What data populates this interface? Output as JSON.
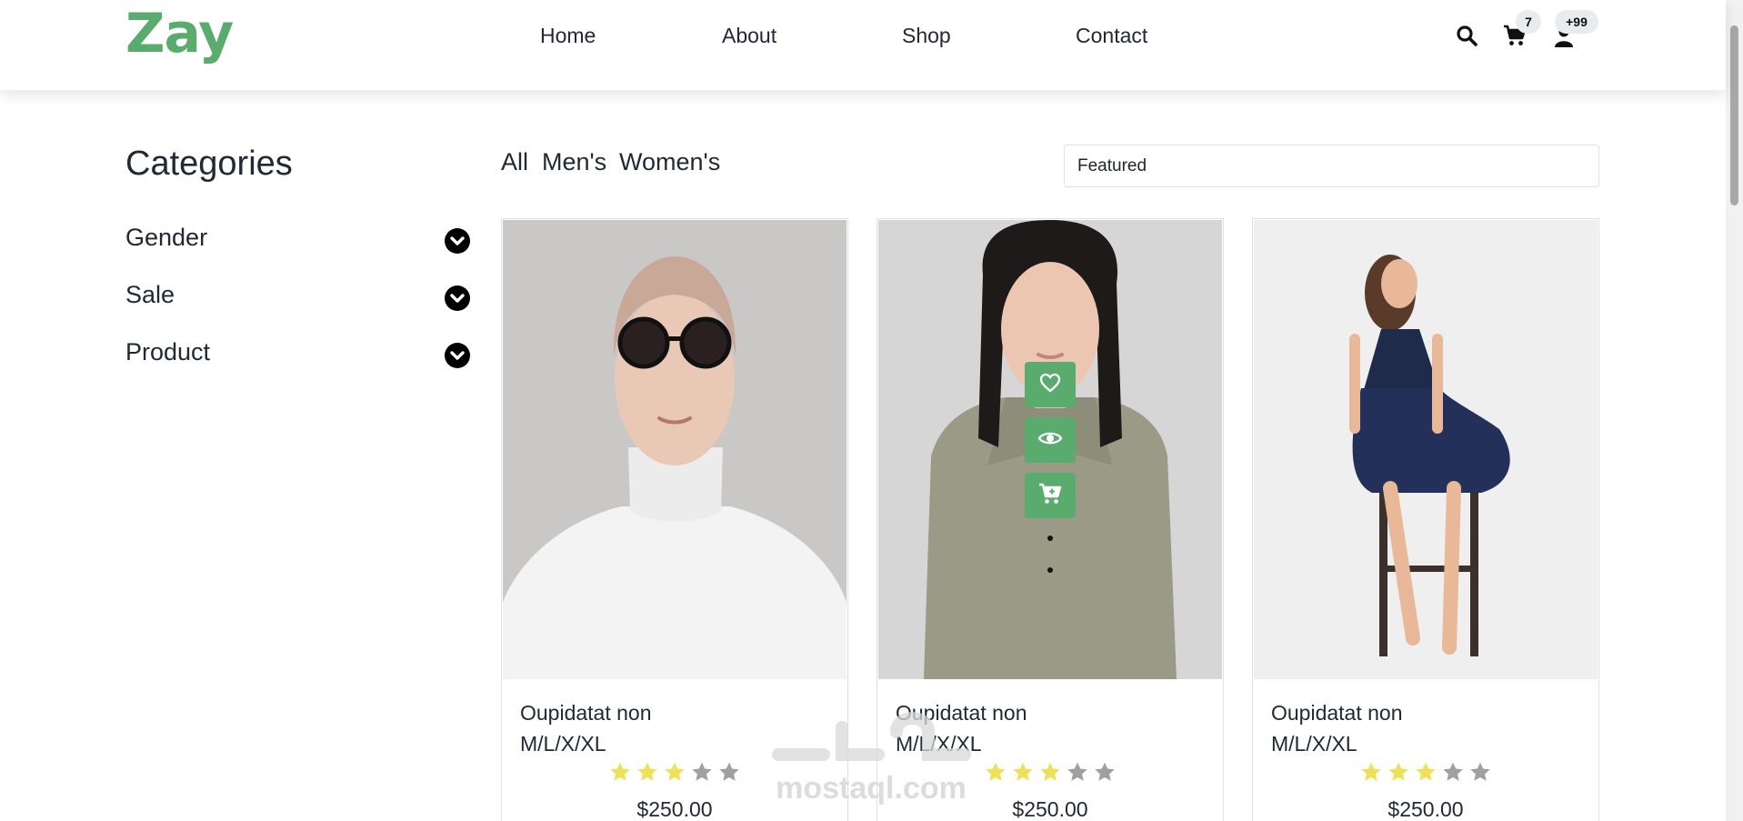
{
  "header": {
    "logo": "Zay",
    "nav": [
      {
        "label": "Home"
      },
      {
        "label": "About"
      },
      {
        "label": "Shop"
      },
      {
        "label": "Contact"
      }
    ],
    "cart_count": "7",
    "user_count": "+99",
    "icons": [
      "search-icon",
      "cart-icon",
      "user-icon"
    ],
    "accent_color": "#59ab6e"
  },
  "sidebar": {
    "title": "Categories",
    "items": [
      {
        "label": "Gender"
      },
      {
        "label": "Sale"
      },
      {
        "label": "Product"
      }
    ]
  },
  "filters": {
    "tabs": [
      {
        "label": "All"
      },
      {
        "label": "Men's"
      },
      {
        "label": "Women's"
      }
    ],
    "sort_selected": "Featured"
  },
  "products": [
    {
      "name": "Oupidatat non",
      "sizes": "M/L/X/XL",
      "rating": 3,
      "max_rating": 5,
      "price": "$250.00"
    },
    {
      "name": "Oupidatat non",
      "sizes": "M/L/X/XL",
      "rating": 3,
      "max_rating": 5,
      "price": "$250.00",
      "hover_actions": [
        "heart-icon",
        "eye-icon",
        "cart-plus-icon"
      ]
    },
    {
      "name": "Oupidatat non",
      "sizes": "M/L/X/XL",
      "rating": 3,
      "max_rating": 5,
      "price": "$250.00"
    }
  ],
  "watermark": {
    "text": "mostaql.com"
  }
}
